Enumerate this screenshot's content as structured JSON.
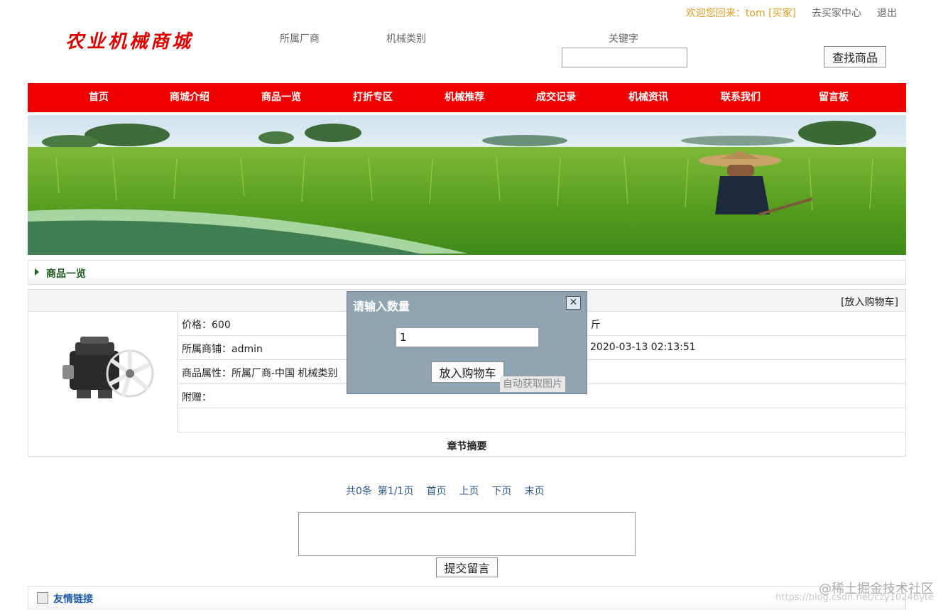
{
  "userbar": {
    "welcome": "欢迎您回来：tom [买家]",
    "buyer_center": "去买家中心",
    "logout": "退出"
  },
  "header": {
    "logo": "农业机械商城",
    "manufacturer_label": "所属厂商",
    "category_label": "机械类别",
    "keyword_label": "关键字",
    "keyword_value": "",
    "search_button": "查找商品"
  },
  "nav": {
    "items": [
      "首页",
      "商城介绍",
      "商品一览",
      "打折专区",
      "机械推荐",
      "成交记录",
      "机械资讯",
      "联系我们",
      "留言板"
    ]
  },
  "section": {
    "title": "商品一览"
  },
  "product": {
    "add_to_cart_link": "[放入购物车]",
    "price": "价格：600",
    "price_right": "斤",
    "shop": "所属商铺：admin",
    "date": "2020-03-13 02:13:51",
    "attributes": "商品属性：所属厂商-中国   机械类别",
    "gift": "附赠：",
    "summary": "章节摘要"
  },
  "pager": {
    "total": "共0条",
    "page": "第1/1页",
    "first": "首页",
    "prev": "上页",
    "next": "下页",
    "last": "末页"
  },
  "comment": {
    "value": "",
    "submit": "提交留言"
  },
  "friend_links": {
    "title": "友情链接"
  },
  "modal": {
    "title": "请输入数量",
    "close": "✕",
    "quantity": "1",
    "add_button": "放入购物车",
    "auto_image": "自动获取图片"
  },
  "watermark": {
    "line1": "@稀土掘金技术社区",
    "line2": "https://blog.csdn.net/czy1024byte"
  },
  "colors": {
    "nav_bg": "#f00000",
    "logo": "#e00000",
    "welcome": "#e09a1a",
    "modal_bg": "#8fa3b0"
  }
}
